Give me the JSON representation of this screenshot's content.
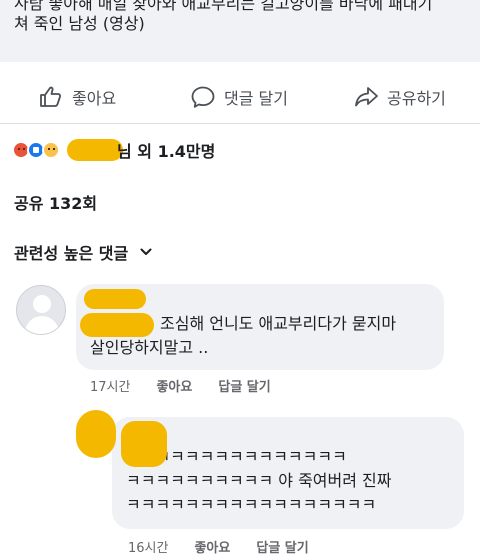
{
  "post": {
    "caption_lines": [
      "사람 좋아해 매일 찾아와 애교부리는 길고양이를 바닥에 패대기",
      "쳐 죽인 남성 (영상)"
    ]
  },
  "actions": {
    "like": "좋아요",
    "comment": "댓글 달기",
    "share": "공유하기"
  },
  "reactions": {
    "emojis": [
      "angry",
      "like",
      "sad"
    ],
    "text": "님 외 1.4만명"
  },
  "shares_text": "공유 132회",
  "comments_filter": "관련성 높은 댓글",
  "comments": [
    {
      "lines": [
        "조심해 언니도 애교부리다가 묻지마",
        "살인당하지말고 .."
      ],
      "time": "17시간",
      "like_label": "좋아요",
      "reply_label": "답글 달기"
    },
    {
      "lines": [
        "ㅋㅋㅋㅋㅋㅋㅋㅋㅋㅋㅋㅋㅋㅋㅋ",
        "ㅋㅋㅋㅋㅋㅋㅋㅋㅋㅋ 야 죽여버려 진짜",
        "ㅋㅋㅋㅋㅋㅋㅋㅋㅋㅋㅋㅋㅋㅋㅋㅋㅋ"
      ],
      "time": "16시간",
      "like_label": "좋아요",
      "reply_label": "답글 달기"
    }
  ],
  "colors": {
    "redaction": "#f5b800",
    "bubble": "#eff1f4"
  }
}
